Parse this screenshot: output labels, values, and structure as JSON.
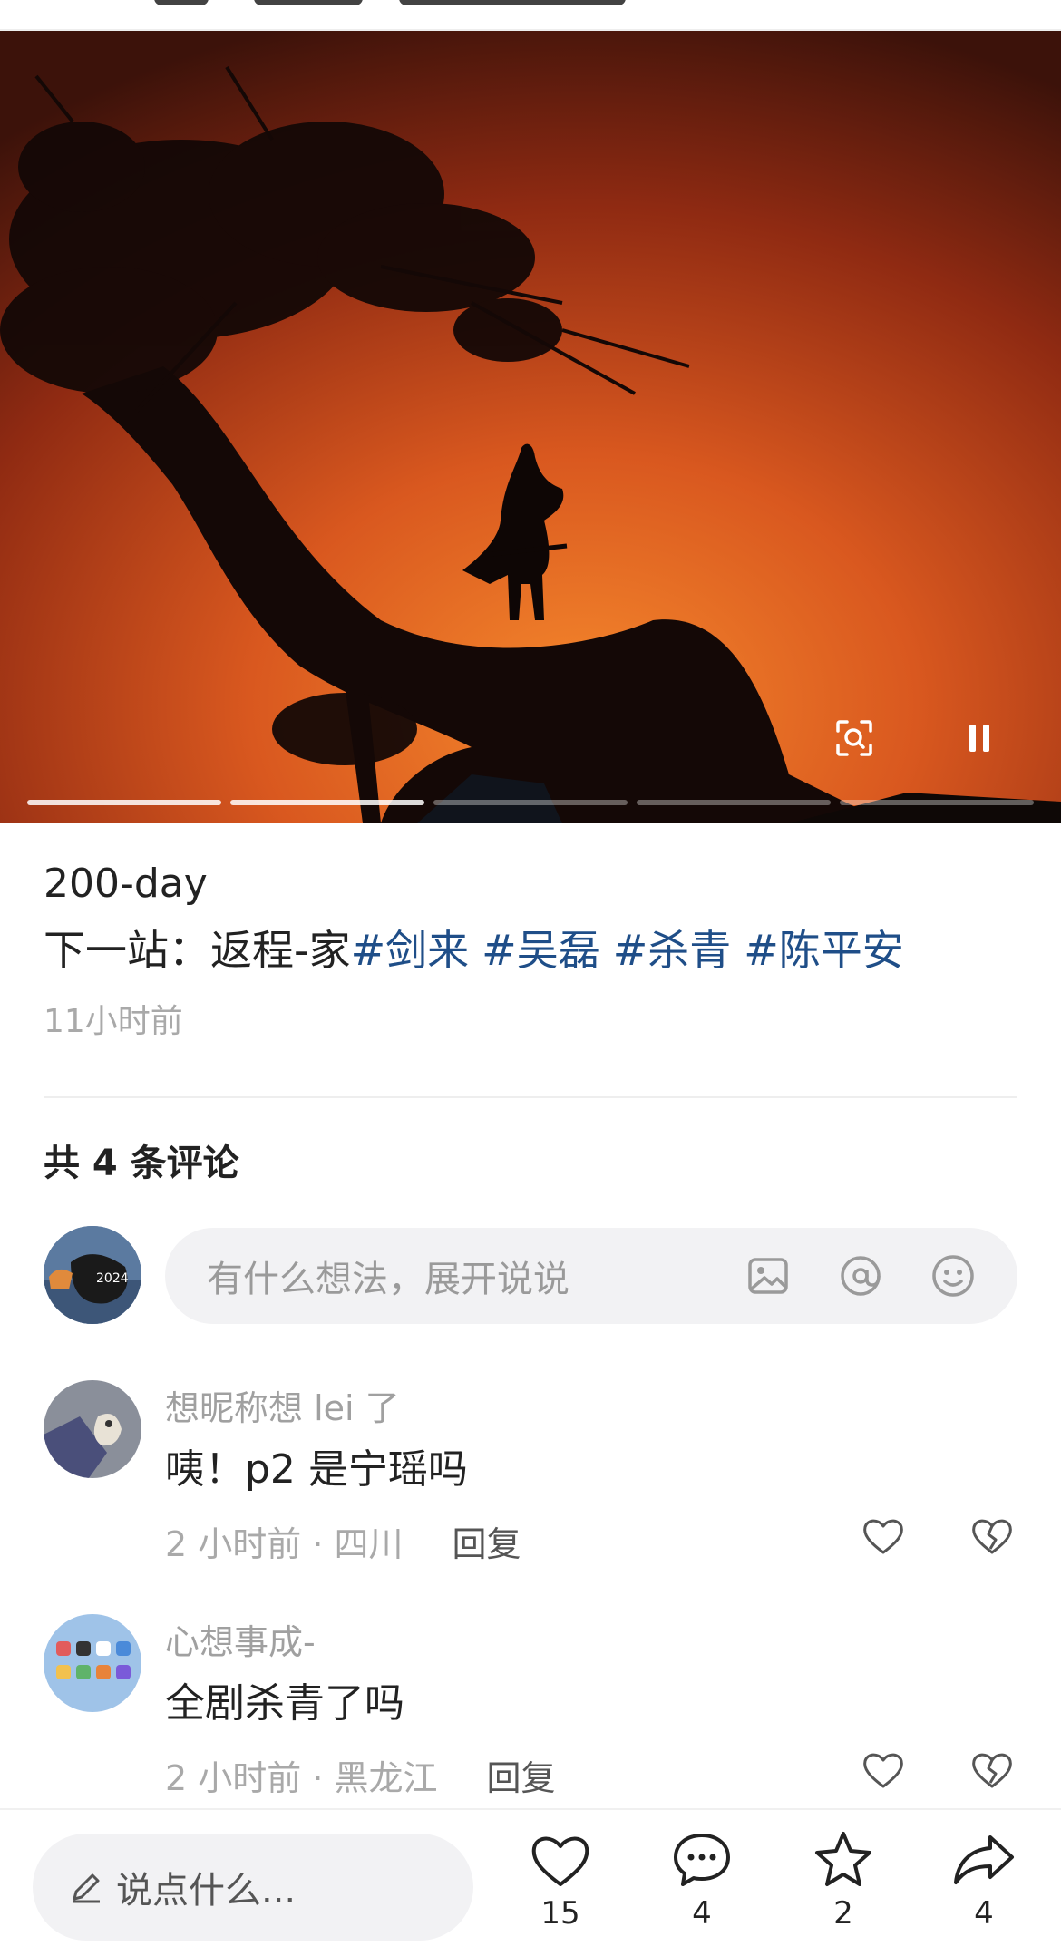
{
  "photo": {
    "progress_segments": 5,
    "active_segments": 2,
    "scan_icon": "scan-search-icon",
    "pause_icon": "pause-icon"
  },
  "post": {
    "title": "200-day",
    "text_prefix": "下一站：返程-家",
    "tags": [
      "#剑来",
      "#吴磊",
      "#杀青",
      "#陈平安"
    ],
    "time": "11小时前"
  },
  "comments_header": "共 4 条评论",
  "comment_input": {
    "placeholder": "有什么想法，展开说说",
    "avatar_text": "2024",
    "icons": [
      "image-icon",
      "at-icon",
      "emoji-icon"
    ]
  },
  "comments": [
    {
      "name": "想昵称想 lei 了",
      "text": "咦！p2 是宁瑶吗",
      "meta": "2 小时前 · 四川",
      "reply_label": "回复"
    },
    {
      "name": "心想事成-",
      "text": "全剧杀青了吗",
      "meta": "2 小时前 · 黑龙江",
      "reply_label": "回复"
    }
  ],
  "bottom_bar": {
    "input_placeholder": "说点什么...",
    "likes": "15",
    "comments": "4",
    "favorites": "2",
    "shares": "4"
  },
  "colors": {
    "tag": "#1f4e88",
    "muted": "#a9a9a9",
    "input_bg": "#f2f2f4"
  }
}
